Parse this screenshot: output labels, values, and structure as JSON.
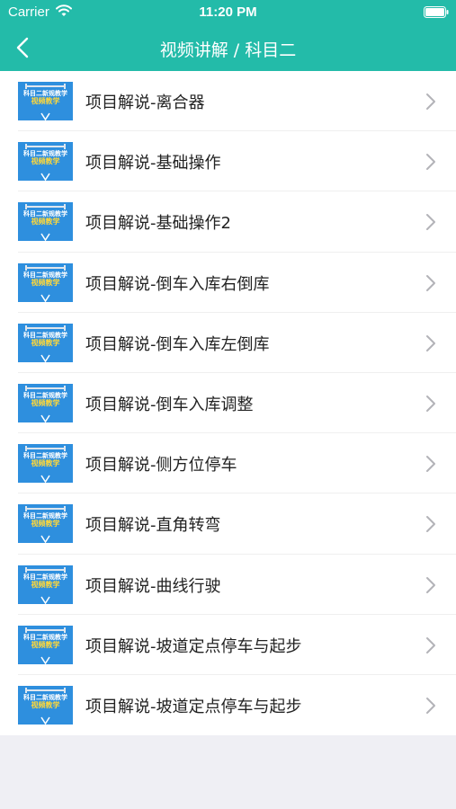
{
  "status_bar": {
    "carrier": "Carrier",
    "time": "11:20 PM",
    "icons": [
      "wifi-icon",
      "battery-icon"
    ]
  },
  "nav": {
    "title": "视频讲解 / 科目二",
    "back_icon": "back-chevron-icon"
  },
  "thumbnail": {
    "line1": "科目二新规教学",
    "line2": "视频教学",
    "icon": "down-arrow-icon"
  },
  "items": [
    {
      "label": "项目解说-离合器"
    },
    {
      "label": "项目解说-基础操作"
    },
    {
      "label": "项目解说-基础操作2"
    },
    {
      "label": "项目解说-倒车入库右倒库"
    },
    {
      "label": "项目解说-倒车入库左倒库"
    },
    {
      "label": "项目解说-倒车入库调整"
    },
    {
      "label": "项目解说-侧方位停车"
    },
    {
      "label": "项目解说-直角转弯"
    },
    {
      "label": "项目解说-曲线行驶"
    },
    {
      "label": "项目解说-坡道定点停车与起步"
    },
    {
      "label": "项目解说-坡道定点停车与起步"
    }
  ],
  "colors": {
    "nav_background": "#23bba9",
    "thumbnail_background": "#2e8fde",
    "thumbnail_accent": "#ffd83a",
    "chevron": "#b3b3b8",
    "page_background": "#efeff4"
  }
}
